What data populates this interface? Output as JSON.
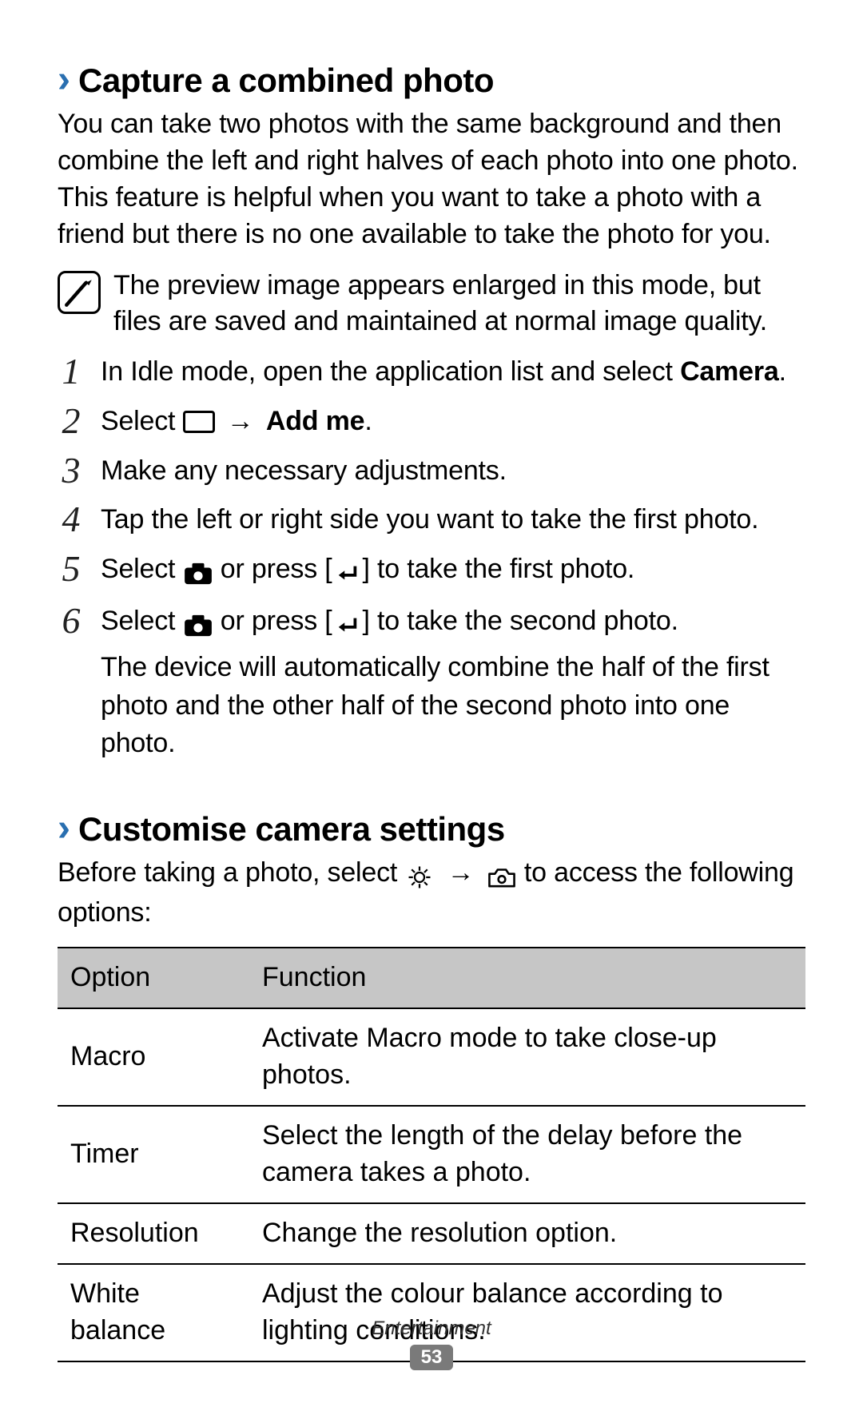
{
  "section1": {
    "heading": "Capture a combined photo",
    "intro": "You can take two photos with the same background and then combine the left and right halves of each photo into one photo. This feature is helpful when you want to take a photo with a friend but there is no one available to take the photo for you.",
    "note": "The preview image appears enlarged in this mode, but files are saved and maintained at normal image quality.",
    "steps": {
      "s1": {
        "num": "1",
        "pre": "In Idle mode, open the application list and select ",
        "bold": "Camera",
        "post": "."
      },
      "s2": {
        "num": "2",
        "pre": "Select ",
        "mid": " → ",
        "bold": "Add me",
        "post": "."
      },
      "s3": {
        "num": "3",
        "text": "Make any necessary adjustments."
      },
      "s4": {
        "num": "4",
        "text": "Tap the left or right side you want to take the first photo."
      },
      "s5": {
        "num": "5",
        "pre": "Select ",
        "mid": " or press [",
        "post": "] to take the first photo."
      },
      "s6": {
        "num": "6",
        "pre": "Select ",
        "mid": " or press [",
        "post": "] to take the second photo.",
        "sub": "The device will automatically combine the half of the first photo and the other half of the second photo into one photo."
      }
    }
  },
  "section2": {
    "heading": "Customise camera settings",
    "intro_pre": "Before taking a photo, select ",
    "intro_mid": " → ",
    "intro_post": " to access the following options:",
    "table": {
      "head_option": "Option",
      "head_function": "Function",
      "rows": [
        {
          "option": "Macro",
          "func": "Activate Macro mode to take close-up photos."
        },
        {
          "option": "Timer",
          "func": "Select the length of the delay before the camera takes a photo."
        },
        {
          "option": "Resolution",
          "func": "Change the resolution option."
        },
        {
          "option": "White balance",
          "func": "Adjust the colour balance according to lighting conditions."
        }
      ]
    }
  },
  "footer": {
    "label": "Entertainment",
    "page": "53"
  }
}
